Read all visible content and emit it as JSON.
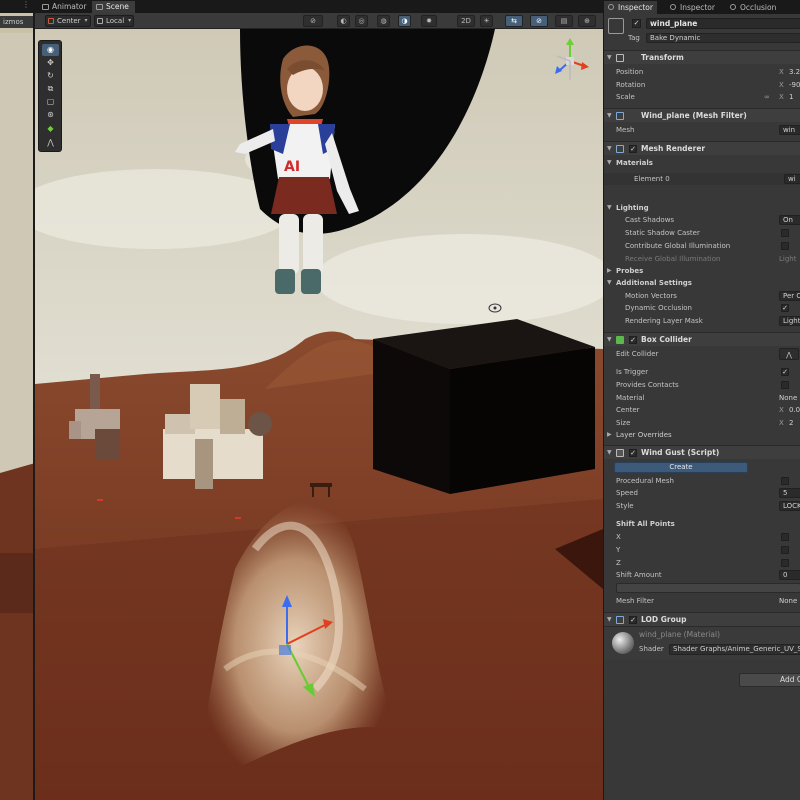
{
  "editor_tabs": {
    "more": "⋮",
    "animator": "Animator",
    "scene": "Scene"
  },
  "left_panel": {
    "label": "izmos"
  },
  "scene_toolbar": {
    "pivot": "Center",
    "space": "Local",
    "mode_2d": "2D"
  },
  "tools": [
    "view-tool",
    "move-tool",
    "rotate-tool",
    "scale-tool",
    "rect-tool",
    "transform-tool",
    "custom-tool",
    "editor-tool"
  ],
  "inspector_tabs": [
    "Inspector",
    "Inspector",
    "Occlusion"
  ],
  "object": {
    "name": "wind_plane",
    "tag_label": "Tag",
    "tag_value": "Bake Dynamic"
  },
  "transform": {
    "title": "Transform",
    "position_label": "Position",
    "position_x": "3.2",
    "rotation_label": "Rotation",
    "rotation_x": "-90",
    "scale_label": "Scale",
    "scale_x": "1"
  },
  "mesh_filter": {
    "title": "Wind_plane (Mesh Filter)",
    "mesh_label": "Mesh",
    "mesh_value": "win"
  },
  "mesh_renderer": {
    "title": "Mesh Renderer",
    "materials_label": "Materials",
    "element0_label": "Element 0",
    "element0_value": "wi",
    "lighting_label": "Lighting",
    "cast_shadows_label": "Cast Shadows",
    "cast_shadows_value": "On",
    "static_shadow_label": "Static Shadow Caster",
    "contribute_gi_label": "Contribute Global Illumination",
    "receive_gi_label": "Receive Global Illumination",
    "receive_gi_value": "Light",
    "probes_label": "Probes",
    "additional_label": "Additional Settings",
    "motion_vectors_label": "Motion Vectors",
    "motion_vectors_value": "Per O",
    "dynamic_occlusion_label": "Dynamic Occlusion",
    "rendering_layer_label": "Rendering Layer Mask",
    "rendering_layer_value": "Light"
  },
  "box_collider": {
    "title": "Box Collider",
    "edit_label": "Edit Collider",
    "is_trigger_label": "Is Trigger",
    "provides_contacts_label": "Provides Contacts",
    "material_label": "Material",
    "material_value": "None",
    "center_label": "Center",
    "center_x": "0.0",
    "size_label": "Size",
    "size_x": "2",
    "layer_overrides_label": "Layer Overrides"
  },
  "wind_gust": {
    "title": "Wind Gust (Script)",
    "create_label": "Create",
    "procedural_mesh_label": "Procedural Mesh",
    "speed_label": "Speed",
    "speed_value": "5",
    "style_label": "Style",
    "style_value": "LOCK",
    "shift_all_points_label": "Shift All Points",
    "x_label": "X",
    "y_label": "Y",
    "z_label": "Z",
    "shift_amount_label": "Shift Amount",
    "shift_amount_value": "0",
    "mesh_filter_label": "Mesh Filter",
    "mesh_filter_value": "None"
  },
  "lod_group": {
    "title": "LOD Group"
  },
  "material_preview": {
    "name": "wind_plane (Material)",
    "shader_label": "Shader",
    "shader_value": "Shader Graphs/Anime_Generic_UV_S"
  },
  "add_component_label": "Add C",
  "axis_x": "X",
  "check_mark": "✓",
  "colors": {
    "panel_bg": "#383838",
    "accent_blue": "#3d5a7a",
    "sky": "#d9dcd2",
    "ground": "#7a3a22"
  }
}
